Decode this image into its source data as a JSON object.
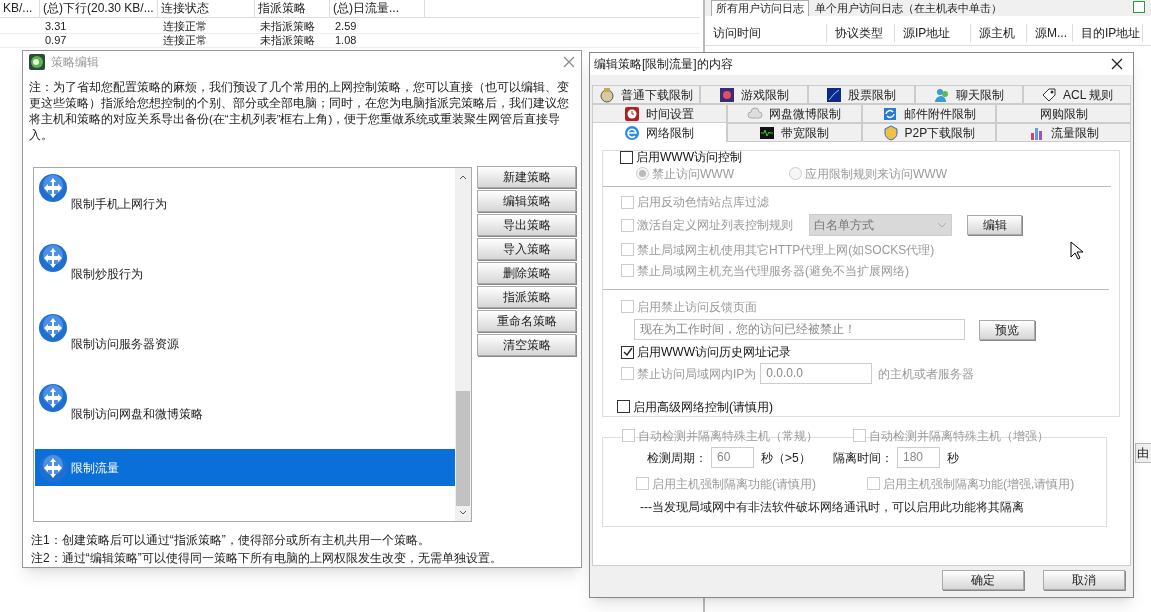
{
  "background": {
    "table": {
      "columns": [
        "KB/...",
        "(总)下行(20.30 KB/...",
        "连接状态",
        "指派策略",
        "(总)日流量..."
      ],
      "rows": [
        [
          "",
          "3.31",
          "连接正常",
          "未指派策略",
          "2.59"
        ],
        [
          "",
          "0.97",
          "连接正常",
          "未指派策略",
          "1.08"
        ]
      ]
    },
    "log_panel": {
      "tabs": [
        {
          "label": "所有用户访问日志",
          "selected": true
        },
        {
          "label": "单个用户访问日志（在主机表中单击）",
          "selected": false
        }
      ],
      "columns": [
        "访问时间",
        "协议类型",
        "源IP地址",
        "源主机",
        "源M...",
        "目的IP地址"
      ],
      "checkbox": {
        "checked": false
      }
    },
    "edge_text": "由"
  },
  "policy_dialog": {
    "title": "策略编辑",
    "note": "注：为了省却您配置策略的麻烦，我们预设了几个常用的上网控制策略，您可以直接（也可以编辑、变更这些策略）指派给您想控制的个别、部分或全部电脑；同时，在您为电脑指派完策略后，我们建议您将主机和策略的对应关系导出备份(在“主机列表”框右上角)，便于您重做系统或重装聚生网管后直接导入。",
    "policies": [
      {
        "label": "限制手机上网行为",
        "selected": false
      },
      {
        "label": "限制炒股行为",
        "selected": false
      },
      {
        "label": "限制访问服务器资源",
        "selected": false
      },
      {
        "label": "限制访问网盘和微博策略",
        "selected": false
      },
      {
        "label": "限制流量",
        "selected": true
      }
    ],
    "buttons": [
      "新建策略",
      "编辑策略",
      "导出策略",
      "导入策略",
      "删除策略",
      "指派策略",
      "重命名策略",
      "清空策略"
    ],
    "footnotes": [
      "注1：创建策略后可以通过“指派策略”，使得部分或所有主机共用一个策略。",
      "注2：通过“编辑策略”可以使得同一策略下所有电脑的上网权限发生改变，无需单独设置。"
    ]
  },
  "edit_dialog": {
    "title": "编辑策略[限制流量]的内容",
    "tab_rows": [
      [
        {
          "label": "普通下载限制",
          "selected": false
        },
        {
          "label": "游戏限制",
          "selected": false
        },
        {
          "label": "股票限制",
          "selected": false
        },
        {
          "label": "聊天限制",
          "selected": false
        },
        {
          "label": "ACL 规则",
          "selected": false
        }
      ],
      [
        {
          "label": "时间设置",
          "selected": false
        },
        {
          "label": "网盘微博限制",
          "selected": false
        },
        {
          "label": "邮件附件限制",
          "selected": false
        },
        {
          "label": "网购限制",
          "selected": false
        }
      ],
      [
        {
          "label": "网络限制",
          "selected": true
        },
        {
          "label": "带宽限制",
          "selected": false
        },
        {
          "label": "P2P下载限制",
          "selected": false
        },
        {
          "label": "流量限制",
          "selected": false
        }
      ]
    ],
    "www_control": {
      "label": "启用WWW访问控制",
      "checked": false,
      "disabled": false
    },
    "www_modes": [
      {
        "label": "禁止访问WWW",
        "selected": true
      },
      {
        "label": "应用限制规则来访问WWW",
        "selected": false
      }
    ],
    "url_filter": {
      "label": "启用反动色情站点库过滤",
      "checked": false,
      "disabled": true
    },
    "custom_list": {
      "label": "激活自定义网址列表控制规则",
      "checked": false,
      "disabled": true,
      "mode": "白名单方式",
      "button": "编辑"
    },
    "proxy_options": [
      {
        "label": "禁止局域网主机使用其它HTTP代理上网(如SOCKS代理)",
        "checked": false,
        "disabled": true
      },
      {
        "label": "禁止局域网主机充当代理服务器(避免不当扩展网络)",
        "checked": false,
        "disabled": true
      }
    ],
    "feedback": {
      "label": "启用禁止访问反馈页面",
      "checked": false,
      "disabled": true,
      "message": "现在为工作时间，您的访问已经被禁止！",
      "button": "预览"
    },
    "history": {
      "label": "启用WWW访问历史网址记录",
      "checked": true,
      "disabled": false
    },
    "lan_block": {
      "label": "禁止访问局域网内IP为",
      "checked": false,
      "disabled": true,
      "ip": "0.0.0.0",
      "suffix": "的主机或者服务器"
    },
    "advanced": {
      "label": "启用高级网络控制(请慎用)",
      "checked": false,
      "disabled": false
    },
    "detect_options": [
      {
        "label": "自动检测并隔离特殊主机（常规）",
        "checked": false,
        "disabled": true
      },
      {
        "label": "自动检测并隔离特殊主机（增强）",
        "checked": false,
        "disabled": true
      }
    ],
    "detect_period": {
      "label": "检测周期：",
      "value": "60",
      "unit": "秒（>5）"
    },
    "isolate_time": {
      "label": "隔离时间：",
      "value": "180",
      "unit": "秒"
    },
    "force_options": [
      {
        "label": "启用主机强制隔离功能(请慎用)",
        "checked": false,
        "disabled": true
      },
      {
        "label": "启用主机强制隔离功能(增强,请慎用)",
        "checked": false,
        "disabled": true
      }
    ],
    "hint": "---当发现局域网中有非法软件破坏网络通讯时，可以启用此功能将其隔离",
    "buttons": [
      "确定",
      "取消"
    ]
  }
}
